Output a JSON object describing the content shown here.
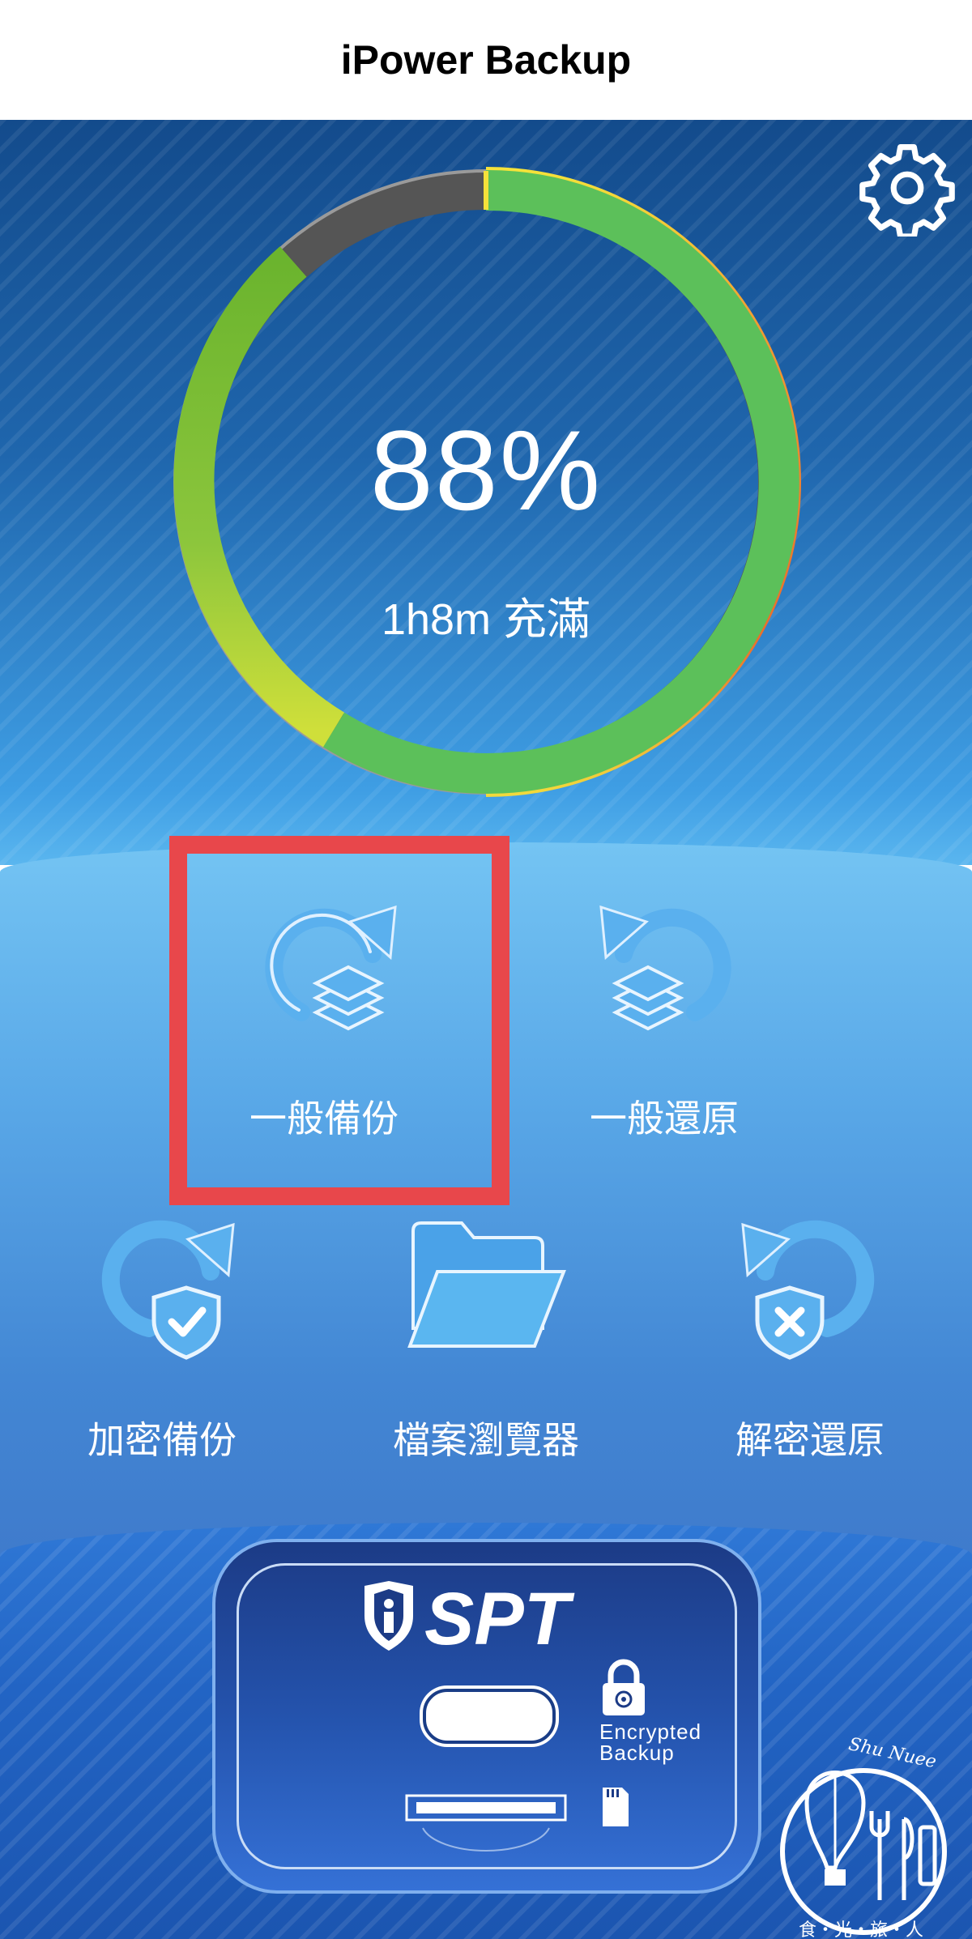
{
  "header": {
    "title": "iPower Backup"
  },
  "gauge": {
    "percent": "88%",
    "charge_level": 0.88,
    "subtitle": "1h8m 充滿"
  },
  "actions": {
    "normal_backup": "一般備份",
    "normal_restore": "一般還原",
    "encrypted_backup": "加密備份",
    "file_browser": "檔案瀏覽器",
    "decrypt_restore": "解密還原"
  },
  "device": {
    "brand": "SPT",
    "lock_label_line1": "Encrypted",
    "lock_label_line2": "Backup"
  },
  "watermark": {
    "top_text": "Shu Nuee",
    "bottom_text": "食・光・旅・人"
  },
  "colors": {
    "highlight": "#e8474b",
    "ring_green": "#5cc05a",
    "ring_orange": "#ec6d2b",
    "ring_track": "#555555"
  }
}
